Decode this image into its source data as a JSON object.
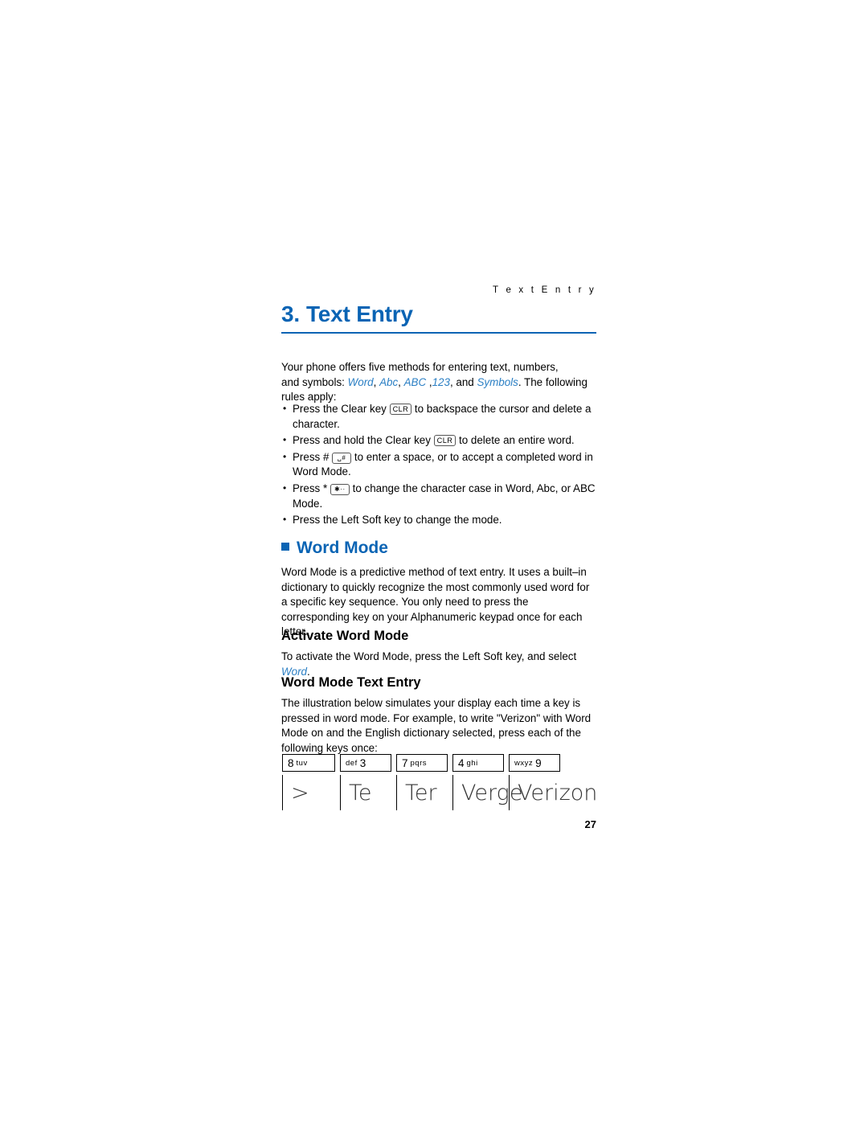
{
  "header": {
    "running_title": "T e x t   E n t r y"
  },
  "chapter": {
    "number": "3.",
    "title": "Text Entry"
  },
  "intro": {
    "line1": "Your phone offers five methods for entering text, numbers,",
    "line2_prefix": "and symbols: ",
    "mode_word": "Word",
    "mode_abc_mixed": "Abc",
    "mode_abc_upper": "ABC",
    "mode_123": "123",
    "mode_and": ", and ",
    "mode_symbols": "Symbols",
    "line2_suffix": ". The following",
    "line3": "rules apply:"
  },
  "rules": [
    {
      "before": "Press the Clear key ",
      "key": "CLR",
      "key_name": "clear-key",
      "after": " to backspace the cursor and delete a character."
    },
    {
      "before": "Press and hold the Clear key ",
      "key": "CLR",
      "key_name": "clear-key",
      "after": " to delete an entire word."
    },
    {
      "before": "Press # ",
      "key": "␣#",
      "key_name": "pound-space-key",
      "after": " to enter a space, or to accept a completed word in Word Mode."
    },
    {
      "before": "Press * ",
      "key": "✱··",
      "key_name": "star-key",
      "after": " to change the character case in Word, Abc, or ABC Mode."
    },
    {
      "before": "Press the Left Soft key to change the mode.",
      "key": "",
      "key_name": "",
      "after": ""
    }
  ],
  "word_mode": {
    "heading": "Word Mode",
    "paragraph": "Word Mode is a predictive method of text entry. It uses a built–in dictionary to quickly recognize the most commonly used word for a specific key sequence. You only need to press the corresponding key on your Alphanumeric keypad once for each letter."
  },
  "activate": {
    "heading": "Activate Word Mode",
    "text_before": "To activate the Word Mode, press the Left Soft key, and select ",
    "link": "Word",
    "text_after": "."
  },
  "text_entry": {
    "heading": "Word Mode Text Entry",
    "paragraph": "The illustration below simulates your display each time a key is pressed in word mode. For example, to write \"Verizon\" with Word Mode on and the English dictionary selected, press each of the following keys once:"
  },
  "illustration": {
    "keys": [
      {
        "digit": "8",
        "letters": "tuv",
        "reversed": false
      },
      {
        "digit": "3",
        "letters": "def",
        "reversed": true
      },
      {
        "digit": "7",
        "letters": "pqrs",
        "reversed": false
      },
      {
        "digit": "4",
        "letters": "ghi",
        "reversed": false
      },
      {
        "digit": "9",
        "letters": "wxyz",
        "reversed": true
      }
    ],
    "screens": [
      ">",
      "Te",
      "Ter",
      "Verge",
      "Verizon"
    ]
  },
  "page_number": "27"
}
